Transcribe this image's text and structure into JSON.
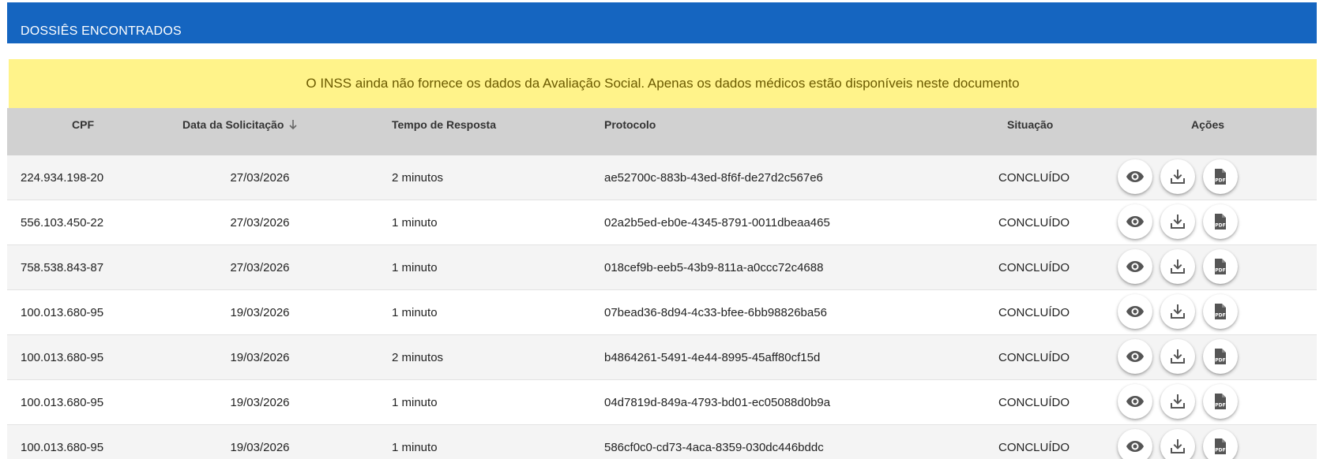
{
  "panel": {
    "title": "DOSSIÊS ENCONTRADOS",
    "header_color": "#1565c0"
  },
  "notice": {
    "text": "O INSS ainda não fornece os dados da Avaliação Social. Apenas os dados médicos estão disponíveis neste documento",
    "background": "#fff38a"
  },
  "table": {
    "headers": {
      "cpf": "CPF",
      "data": "Data da Solicitação",
      "tempo": "Tempo de Resposta",
      "protocolo": "Protocolo",
      "situacao": "Situação",
      "acoes": "Ações"
    },
    "sort_icon": "arrow-down-icon",
    "action_icons": [
      "eye-icon",
      "download-icon",
      "pdf-file-icon"
    ],
    "rows": [
      {
        "cpf": "224.934.198-20",
        "data": "27/03/2026",
        "tempo": "2 minutos",
        "protocolo": "ae52700c-883b-43ed-8f6f-de27d2c567e6",
        "situacao": "CONCLUÍDO"
      },
      {
        "cpf": "556.103.450-22",
        "data": "27/03/2026",
        "tempo": "1 minuto",
        "protocolo": "02a2b5ed-eb0e-4345-8791-0011dbeaa465",
        "situacao": "CONCLUÍDO"
      },
      {
        "cpf": "758.538.843-87",
        "data": "27/03/2026",
        "tempo": "1 minuto",
        "protocolo": "018cef9b-eeb5-43b9-811a-a0ccc72c4688",
        "situacao": "CONCLUÍDO"
      },
      {
        "cpf": "100.013.680-95",
        "data": "19/03/2026",
        "tempo": "1 minuto",
        "protocolo": "07bead36-8d94-4c33-bfee-6bb98826ba56",
        "situacao": "CONCLUÍDO"
      },
      {
        "cpf": "100.013.680-95",
        "data": "19/03/2026",
        "tempo": "2 minutos",
        "protocolo": "b4864261-5491-4e44-8995-45aff80cf15d",
        "situacao": "CONCLUÍDO"
      },
      {
        "cpf": "100.013.680-95",
        "data": "19/03/2026",
        "tempo": "1 minuto",
        "protocolo": "04d7819d-849a-4793-bd01-ec05088d0b9a",
        "situacao": "CONCLUÍDO"
      },
      {
        "cpf": "100.013.680-95",
        "data": "19/03/2026",
        "tempo": "1 minuto",
        "protocolo": "586cf0c0-cd73-4aca-8359-030dc446bddc",
        "situacao": "CONCLUÍDO"
      }
    ]
  }
}
